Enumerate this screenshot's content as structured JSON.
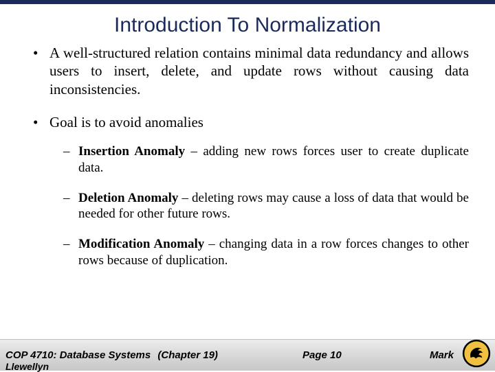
{
  "title": "Introduction To Normalization",
  "bullets": {
    "b1": "A well-structured relation contains minimal data redundancy and allows users to insert, delete, and update rows without causing data inconsistencies.",
    "b2": "Goal is to avoid anomalies",
    "sub1_bold": "Insertion Anomaly",
    "sub1_rest": " – adding new rows forces user to create duplicate data.",
    "sub2_bold": "Deletion Anomaly",
    "sub2_rest": " – deleting rows may cause a loss of data that would be needed for other future rows.",
    "sub3_bold": "Modification Anomaly",
    "sub3_rest": " – changing data in a row forces changes to other rows because of duplication."
  },
  "footer": {
    "course": "COP 4710: Database Systems",
    "chapter": "(Chapter 19)",
    "page": "Page 10",
    "author": "Mark",
    "author_sub": "Llewellyn"
  }
}
